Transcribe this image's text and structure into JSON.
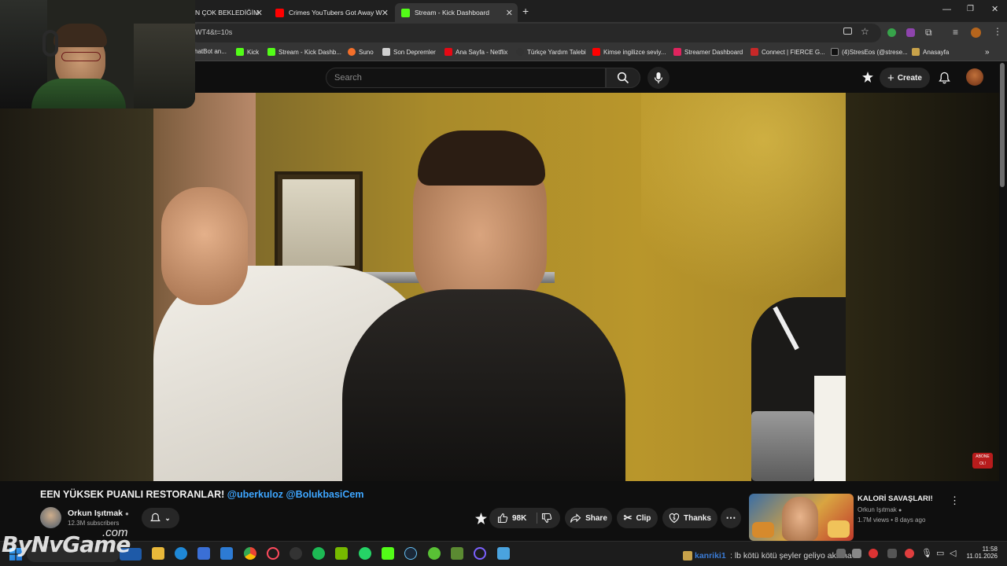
{
  "tabs": [
    {
      "label": "N ÇOK BEKLEDİĞİM",
      "active": false
    },
    {
      "label": "Crimes YouTubers Got Away W",
      "active": false
    },
    {
      "label": "Stream - Kick Dashboard",
      "active": true
    }
  ],
  "address": {
    "url": "WT4&t=10s"
  },
  "bookmarks": [
    {
      "label": "hatBot an...",
      "color": "#9aa0a6"
    },
    {
      "label": "Kick",
      "color": "#53fc18"
    },
    {
      "label": "Stream - Kick Dashb...",
      "color": "#53fc18"
    },
    {
      "label": "Suno",
      "color": "#f46f2a"
    },
    {
      "label": "Son Depremler",
      "color": "#d0d0d0"
    },
    {
      "label": "Ana Sayfa - Netflix",
      "color": "#e50914"
    },
    {
      "label": "Türkçe Yardım Talebi",
      "color": "#333333"
    },
    {
      "label": "Kimse ingilizce seviy...",
      "color": "#ff0000"
    },
    {
      "label": "Streamer Dashboard",
      "color": "#e0245e"
    },
    {
      "label": "Connect | FIERCE G...",
      "color": "#c62828"
    },
    {
      "label": "(4)StresEos (@strese...",
      "color": "#111111"
    },
    {
      "label": "Anasayfa",
      "color": "#c8a24a"
    }
  ],
  "youtube": {
    "search_placeholder": "Search",
    "create_label": "Create"
  },
  "video": {
    "title_main": "EEN YÜKSEK PUANLI RESTORANLAR!",
    "title_tags": "@uberkuloz @BolukbasiCem",
    "channel": "Orkun Işıtmak",
    "subscribers": "12.3M subscribers",
    "likes": "98K",
    "share_label": "Share",
    "clip_label": "Clip",
    "thanks_label": "Thanks",
    "overlay_badge": "ABONE OL!"
  },
  "recommended": {
    "title": "KALORİ SAVAŞLARI!",
    "channel": "Orkun Işıtmak",
    "meta": "1.7M views • 8 days ago"
  },
  "stream_overlay": {
    "logo": "ByNvGame",
    "logo_suffix": ".com",
    "chat_user": "kanriki1",
    "chat_message": ": lb kötü kötü şeyler geliyo aklıma"
  },
  "taskbar": {
    "time": "11:58",
    "date": "11.01.2026"
  }
}
